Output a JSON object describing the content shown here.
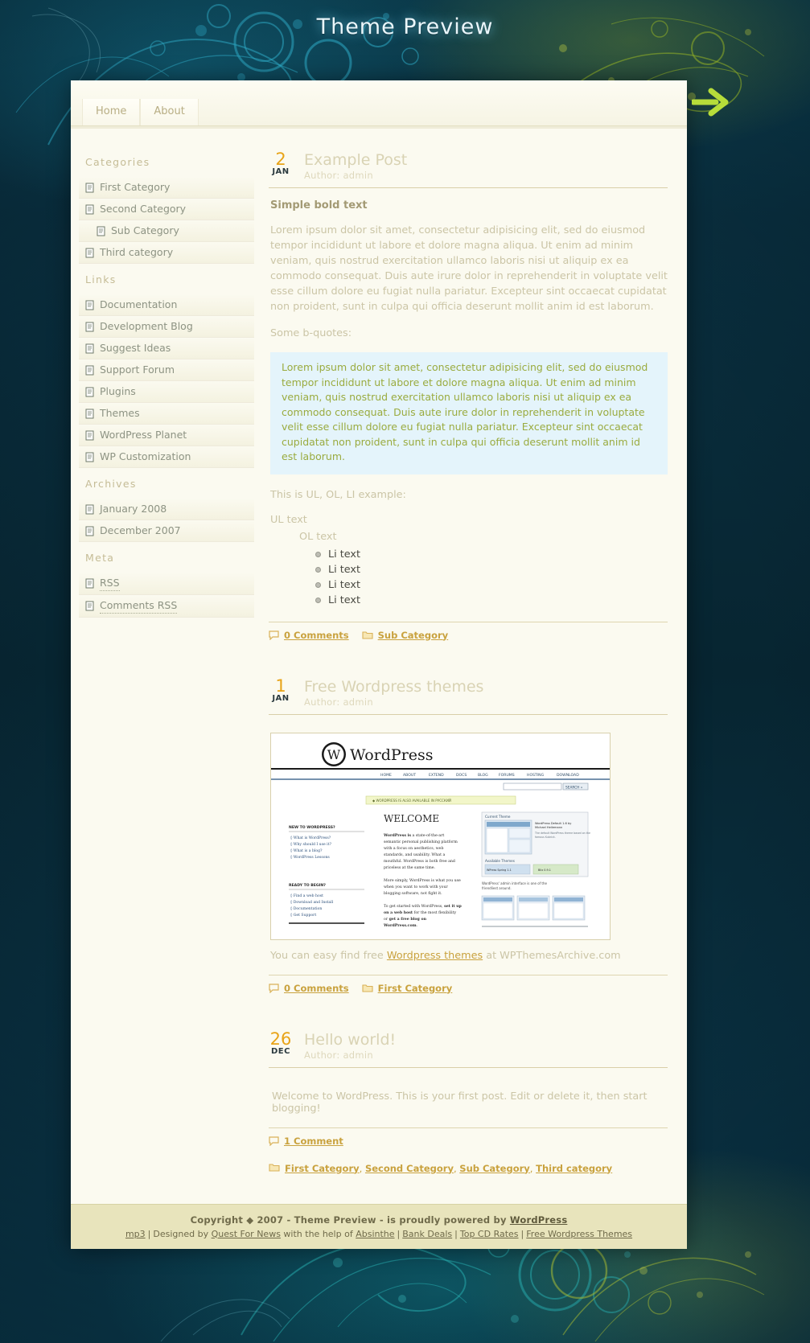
{
  "site": {
    "title": "Theme Preview"
  },
  "nav": {
    "items": [
      {
        "label": "Home",
        "name": "nav-tab-home"
      },
      {
        "label": "About",
        "name": "nav-tab-about"
      }
    ]
  },
  "sidebar": {
    "sections": [
      {
        "heading": "Categories",
        "items": [
          {
            "label": "First Category",
            "sub": false
          },
          {
            "label": "Second Category",
            "sub": false
          },
          {
            "label": "Sub Category",
            "sub": true
          },
          {
            "label": "Third category",
            "sub": false
          }
        ]
      },
      {
        "heading": "Links",
        "items": [
          {
            "label": "Documentation",
            "sub": false
          },
          {
            "label": "Development Blog",
            "sub": false
          },
          {
            "label": "Suggest Ideas",
            "sub": false
          },
          {
            "label": "Support Forum",
            "sub": false
          },
          {
            "label": "Plugins",
            "sub": false
          },
          {
            "label": "Themes",
            "sub": false
          },
          {
            "label": "WordPress Planet",
            "sub": false
          },
          {
            "label": "WP Customization",
            "sub": false
          }
        ]
      },
      {
        "heading": "Archives",
        "items": [
          {
            "label": "January 2008",
            "sub": false
          },
          {
            "label": "December 2007",
            "sub": false
          }
        ]
      },
      {
        "heading": "Meta",
        "items": [
          {
            "label": "RSS",
            "sub": false,
            "dotted": true
          },
          {
            "label": "Comments RSS",
            "sub": false,
            "dotted": true
          }
        ]
      }
    ]
  },
  "posts": [
    {
      "day": "2",
      "month": "JAN",
      "title": "Example Post",
      "author": "Author: admin",
      "bold_text": "Simple bold text",
      "paragraph": "Lorem ipsum dolor sit amet, consectetur adipisicing elit, sed do eiusmod tempor incididunt ut labore et dolore magna aliqua. Ut enim ad minim veniam, quis nostrud exercitation ullamco laboris nisi ut aliquip ex ea commodo consequat. Duis aute irure dolor in reprehenderit in voluptate velit esse cillum dolore eu fugiat nulla pariatur. Excepteur sint occaecat cupidatat non proident, sunt in culpa qui officia deserunt mollit anim id est laborum.",
      "quote_intro": "Some b-quotes:",
      "blockquote": "Lorem ipsum dolor sit amet, consectetur adipisicing elit, sed do eiusmod tempor incididunt ut labore et dolore magna aliqua. Ut enim ad minim veniam, quis nostrud exercitation ullamco laboris nisi ut aliquip ex ea commodo consequat. Duis aute irure dolor in reprehenderit in voluptate velit esse cillum dolore eu fugiat nulla pariatur. Excepteur sint occaecat cupidatat non proident, sunt in culpa qui officia deserunt mollit anim id est laborum.",
      "list_intro": "This is UL, OL, LI example:",
      "ul_text": "UL text",
      "ol_text": "OL text",
      "li_items": [
        "Li text",
        "Li text",
        "Li text",
        "Li text"
      ],
      "comments_label": "0 Comments",
      "categories": [
        "Sub Category"
      ]
    },
    {
      "day": "1",
      "month": "JAN",
      "title": "Free Wordpress themes",
      "author": "Author: admin",
      "caption_prefix": "You can easy find free ",
      "caption_link": "Wordpress themes",
      "caption_suffix": " at WPThemesArchive.com",
      "comments_label": "0 Comments",
      "categories": [
        "First Category"
      ]
    },
    {
      "day": "26",
      "month": "DEC",
      "title": "Hello world!",
      "author": "Author: admin",
      "welcome": "Welcome to WordPress. This is your first post. Edit or delete it, then start blogging!",
      "comments_label": "1 Comment",
      "categories": [
        "First Category",
        "Second Category",
        "Sub Category",
        "Third category"
      ]
    }
  ],
  "screenshot": {
    "logo": "WordPress",
    "nav": [
      "HOME",
      "ABOUT",
      "EXTEND",
      "DOCS",
      "BLOG",
      "FORUMS",
      "HOSTING",
      "DOWNLOAD"
    ],
    "search_button": "SEARCH »",
    "notice": "WORDPRESS IS ALSO AVAILABLE IN РУССКИЙ",
    "welcome_heading": "WELCOME",
    "intro_lead": "WordPress is",
    "intro_text": "a state-of-the-art semantic personal publishing platform with a focus on aesthetics, web standards, and usability. What a mouthful. WordPress is both free and priceless at the same time.",
    "intro_text2": "More simply, WordPress is what you use when you want to work with your blogging software, not fight it.",
    "intro_text3_a": "To get started with WordPress, ",
    "intro_text3_b": "set it up on a web host",
    "intro_text3_c": " for the most flexibility or ",
    "intro_text3_d": "get a free blog on WordPress.com",
    "intro_text3_e": ".",
    "new_heading": "NEW TO WORDPRESS?",
    "new_items": [
      "What is WordPress?",
      "Why should I use it?",
      "What is a blog?",
      "WordPress Lessons"
    ],
    "ready_heading": "READY TO BEGIN?",
    "ready_items": [
      "Find a web host",
      "Download and Install",
      "Documentation",
      "Get Support"
    ],
    "current_theme_label": "Current Theme",
    "current_theme_name": "WordPress Default 1.6 by Michael Heilemann",
    "available_themes_label": "Available Themes",
    "available_theme_1": "WPress Spring 1.1",
    "available_theme_2": "Blix 0.9.1",
    "admin_caption": "WordPress' admin interface is one of the friendliest around."
  },
  "footer": {
    "copyright_a": "Copyright ",
    "copyright_mark": "◆",
    "copyright_b": " 2007 - Theme Preview - is proudly powered by ",
    "wordpress": "WordPress",
    "credits": [
      {
        "label": "mp3",
        "link": true
      },
      {
        "label": "Designed by ",
        "link": false
      },
      {
        "label": "Quest For News",
        "link": true
      },
      {
        "label": " with the help of ",
        "link": false
      },
      {
        "label": "Absinthe",
        "link": true
      },
      {
        "label": "Bank Deals",
        "link": true
      },
      {
        "label": "Top CD Rates",
        "link": true
      },
      {
        "label": "Free Wordpress Themes",
        "link": true
      }
    ]
  },
  "colors": {
    "accent_orange": "#e8a317",
    "link_gold": "#c9a23e",
    "page_bg": "#fbfaf0",
    "footer_bg": "#e8e4bc",
    "quote_bg": "#e4f4fb",
    "quote_text": "#9aab3f"
  }
}
